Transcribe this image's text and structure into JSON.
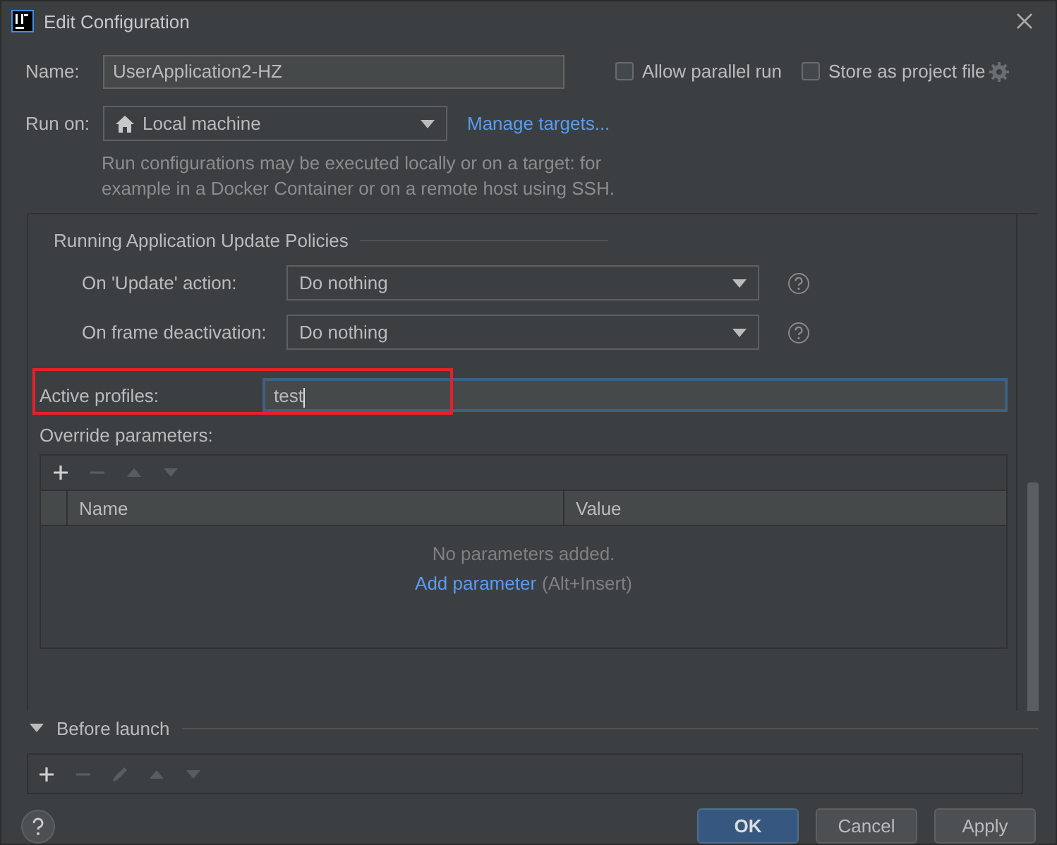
{
  "window": {
    "title": "Edit Configuration"
  },
  "name": {
    "label": "Name:",
    "value": "UserApplication2-HZ"
  },
  "options": [
    {
      "label": "Allow parallel run",
      "checked": false
    },
    {
      "label": "Store as project file",
      "checked": false
    }
  ],
  "run_on": {
    "label": "Run on:",
    "value": "Local machine",
    "link": "Manage targets...",
    "description": "Run configurations may be executed locally or on a target: for example in a Docker Container or on a remote host using SSH."
  },
  "update_policies": {
    "title": "Running Application Update Policies",
    "rows": [
      {
        "label": "On 'Update' action:",
        "value": "Do nothing"
      },
      {
        "label": "On frame deactivation:",
        "value": "Do nothing"
      }
    ]
  },
  "active_profiles": {
    "label": "Active profiles:",
    "value": "test",
    "highlighted": true
  },
  "override_parameters": {
    "label": "Override parameters:",
    "toolbar": [
      {
        "kind": "add",
        "disabled": false
      },
      {
        "kind": "remove",
        "disabled": true
      },
      {
        "kind": "up",
        "disabled": true
      },
      {
        "kind": "down",
        "disabled": true
      }
    ],
    "columns": [
      "Name",
      "Value"
    ],
    "empty_text": "No parameters added.",
    "add_link": "Add parameter",
    "add_hint": "(Alt+Insert)"
  },
  "before_launch": {
    "title": "Before launch",
    "expanded": true,
    "toolbar": [
      {
        "kind": "add",
        "disabled": false
      },
      {
        "kind": "remove",
        "disabled": true
      },
      {
        "kind": "edit",
        "disabled": true
      },
      {
        "kind": "up",
        "disabled": true
      },
      {
        "kind": "down",
        "disabled": true
      }
    ]
  },
  "buttons": [
    {
      "label": "OK",
      "kind": "primary"
    },
    {
      "label": "Cancel",
      "kind": "normal"
    },
    {
      "label": "Apply",
      "kind": "normal"
    }
  ]
}
